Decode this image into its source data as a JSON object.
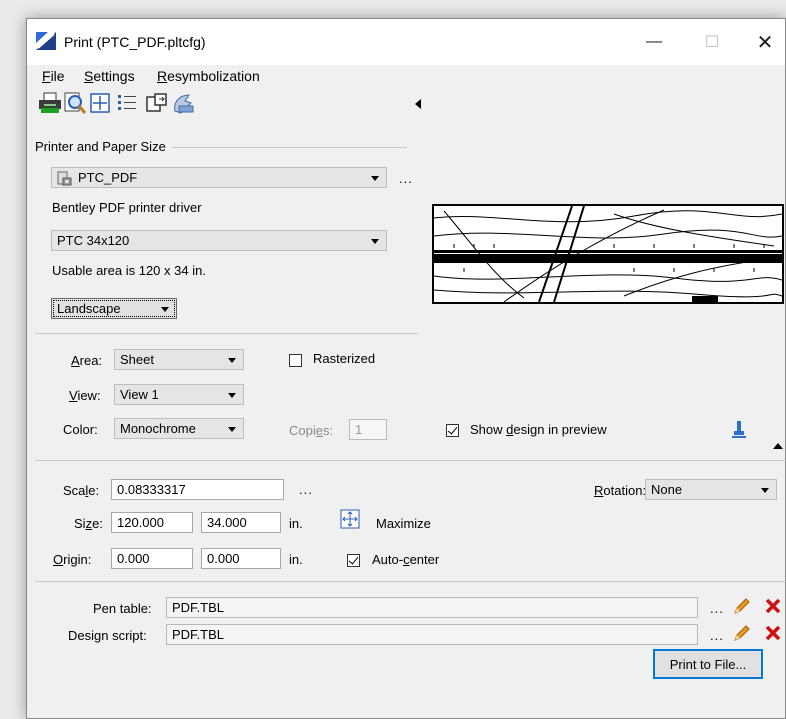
{
  "window": {
    "title": "Print  (PTC_PDF.pltcfg)",
    "minimize": "—",
    "maximize": "☐",
    "close": "✕"
  },
  "menu": [
    "File",
    "Settings",
    "Resymbolization"
  ],
  "toolbar_icons": [
    "printer-icon",
    "preview-icon",
    "fit-area-icon",
    "list-icon",
    "export-icon",
    "spooler-icon"
  ],
  "printer": {
    "section_label": "Printer and Paper Size",
    "printer_name": "PTC_PDF",
    "driver_text": "Bentley PDF printer driver",
    "paper_size": "PTC 34x120",
    "usable_area": "Usable area is 120 x 34 in.",
    "orientation": "Landscape",
    "more": "..."
  },
  "options": {
    "area_label": "Area:",
    "area_value": "Sheet",
    "view_label": "View:",
    "view_value": "View 1",
    "color_label": "Color:",
    "color_value": "Monochrome",
    "rasterized_label": "Rasterized",
    "rasterized_checked": false,
    "copies_label": "Copies:",
    "copies_value": "1",
    "show_design_label": "Show design in preview",
    "show_design_checked": true
  },
  "layout": {
    "scale_label": "Scale:",
    "scale_value": "0.08333317",
    "scale_more": "...",
    "size_label": "Size:",
    "size_w": "120.000",
    "size_h": "34.000",
    "size_unit": "in.",
    "maximize_label": "Maximize",
    "origin_label": "Origin:",
    "origin_x": "0.000",
    "origin_y": "0.000",
    "origin_unit": "in.",
    "autocenter_label": "Auto-center",
    "autocenter_checked": true,
    "rotation_label": "Rotation:",
    "rotation_value": "None"
  },
  "pen_table": {
    "label": "Pen table:",
    "value": "PDF.TBL",
    "more": "..."
  },
  "design_script": {
    "label": "Design script:",
    "value": "PDF.TBL",
    "more": "..."
  },
  "print_button": "Print to File...",
  "colors": {
    "accent": "#0078d7",
    "delete_red": "#d01010",
    "pencil_orange": "#e89a20"
  }
}
